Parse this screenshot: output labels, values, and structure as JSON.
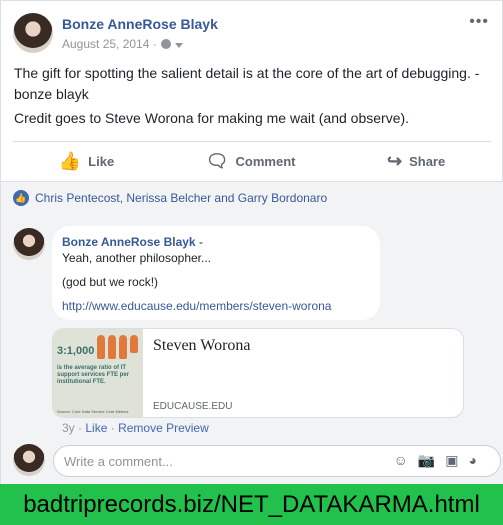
{
  "post": {
    "author": "Bonze AnneRose Blayk",
    "date": "August 25, 2014 ·",
    "body": [
      "The gift for spotting the salient detail is at the core of the art of debugging. - bonze blayk",
      "Credit goes to Steve Worona for making me wait (and observe)."
    ],
    "actions": [
      "Like",
      "Comment",
      "Share"
    ]
  },
  "likers": "Chris Pentecost, Nerissa Belcher and Garry Bordonaro",
  "comment": {
    "author": "Bonze AnneRose Blayk",
    "dash": "-",
    "lines": [
      "Yeah, another philosopher...",
      "(god but we rock!)"
    ],
    "link": "http://www.educause.edu/members/steven-worona",
    "time": "3y",
    "like": "Like",
    "remove": "Remove Preview"
  },
  "preview": {
    "stat": "3:1,000",
    "desc": "is the average ratio of IT support services FTE per institutional FTE.",
    "src": "Source: Core Data Service Core Metrics",
    "title": "Steven Worona",
    "domain": "EDUCAUSE.EDU"
  },
  "compose": {
    "placeholder": "Write a comment..."
  },
  "footer": "badtriprecords.biz/NET_DATAKARMA.html"
}
